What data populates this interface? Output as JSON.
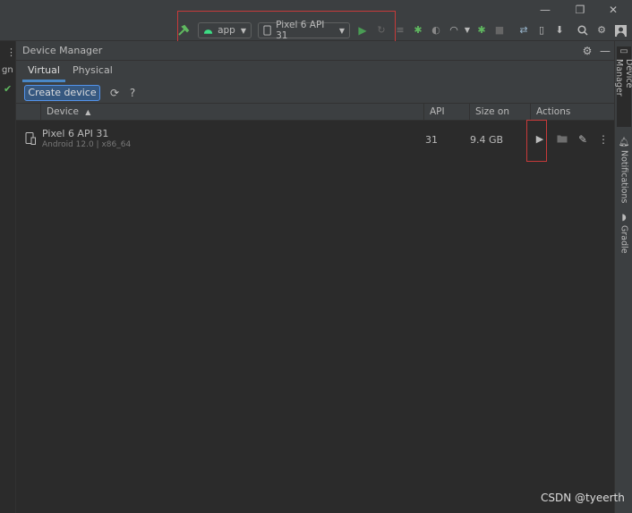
{
  "window": {
    "minimize_glyph": "—",
    "restore_glyph": "❐",
    "close_glyph": "✕"
  },
  "toolbar": {
    "run_config": "app",
    "device_selector": "Pixel 6 API 31"
  },
  "left_strip": {
    "truncated_text": "gn"
  },
  "panel": {
    "title": "Device Manager",
    "tabs": [
      {
        "label": "Virtual",
        "active": true
      },
      {
        "label": "Physical",
        "active": false
      }
    ],
    "create_button": "Create device",
    "help_glyph": "?"
  },
  "table": {
    "columns": [
      "Device",
      "API",
      "Size on Disk",
      "Actions"
    ],
    "sort_indicator": "▲",
    "rows": [
      {
        "name": "Pixel 6 API 31",
        "subtitle": "Android 12.0 | x86_64",
        "api": "31",
        "size": "9.4 GB"
      }
    ]
  },
  "right_strip": {
    "tabs": [
      {
        "label": "Device Manager",
        "icon": "device-manager-icon",
        "active": true
      },
      {
        "label": "Notifications",
        "icon": "bell-icon",
        "active": false
      },
      {
        "label": "Gradle",
        "icon": "gradle-icon",
        "active": false
      }
    ]
  },
  "watermark": "CSDN @tyeerth",
  "colors": {
    "accent": "#4a88c7",
    "run_green": "#499c54",
    "highlight_red": "#c73a3a",
    "android_green": "#3ddc84"
  }
}
